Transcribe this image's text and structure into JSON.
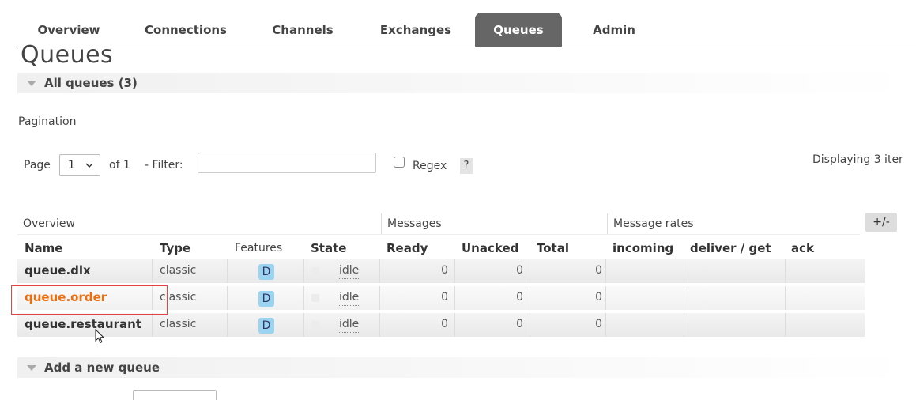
{
  "nav": {
    "tabs": [
      {
        "label": "Overview"
      },
      {
        "label": "Connections"
      },
      {
        "label": "Channels"
      },
      {
        "label": "Exchanges"
      },
      {
        "label": "Queues",
        "active": true
      },
      {
        "label": "Admin"
      }
    ]
  },
  "page": {
    "title": "Queues",
    "all_queues_label": "All queues (3)",
    "add_queue_label": "Add a new queue"
  },
  "pagination": {
    "heading": "Pagination",
    "page_label": "Page",
    "page_value": "1",
    "of_label": "of 1",
    "filter_label": "- Filter:",
    "filter_value": "",
    "regex_label": "Regex",
    "help_label": "?",
    "displaying": "Displaying 3 iter"
  },
  "table": {
    "groups": {
      "overview": "Overview",
      "messages": "Messages",
      "rates": "Message rates"
    },
    "toggle_label": "+/-",
    "columns": {
      "name": "Name",
      "type": "Type",
      "features": "Features",
      "state": "State",
      "ready": "Ready",
      "unacked": "Unacked",
      "total": "Total",
      "incoming": "incoming",
      "deliver": "deliver / get",
      "ack": "ack"
    },
    "rows": [
      {
        "name": "queue.dlx",
        "type": "classic",
        "feature": "D",
        "state": "idle",
        "ready": "0",
        "unacked": "0",
        "total": "0"
      },
      {
        "name": "queue.order",
        "type": "classic",
        "feature": "D",
        "state": "idle",
        "ready": "0",
        "unacked": "0",
        "total": "0"
      },
      {
        "name": "queue.restaurant",
        "type": "classic",
        "feature": "D",
        "state": "idle",
        "ready": "0",
        "unacked": "0",
        "total": "0"
      }
    ]
  },
  "colors": {
    "active_tab": "#666666",
    "highlight_link": "#f06d0c",
    "feature_badge": "#9bd4f0",
    "outline": "#e0463c"
  }
}
